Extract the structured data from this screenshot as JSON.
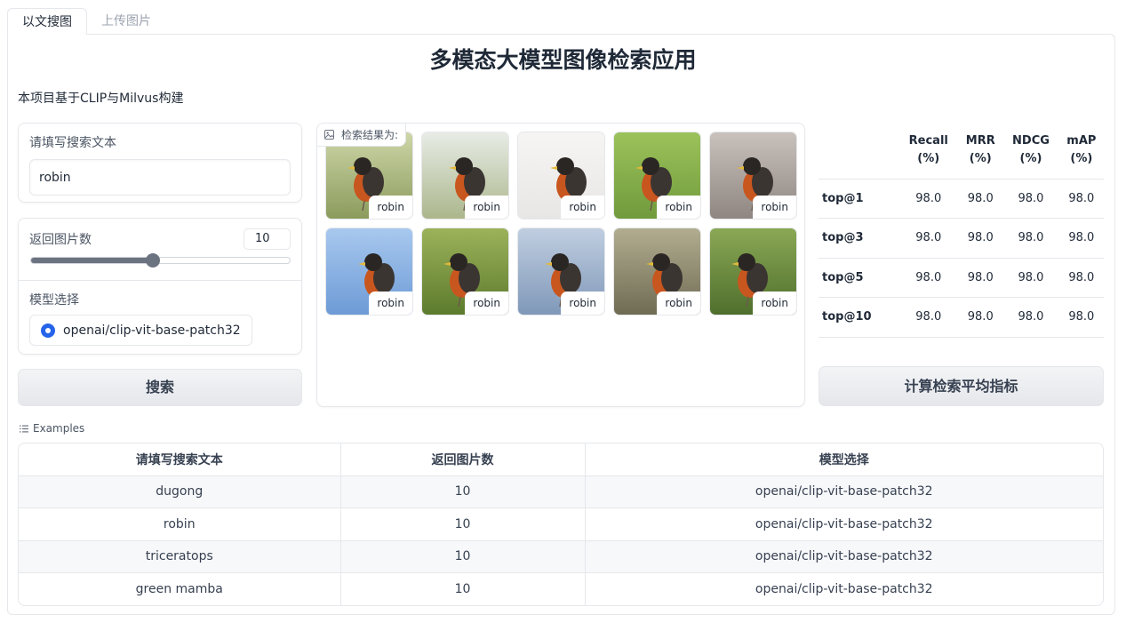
{
  "tabs": [
    {
      "label": "以文搜图",
      "active": true
    },
    {
      "label": "上传图片",
      "active": false
    }
  ],
  "title": "多模态大模型图像检索应用",
  "subtitle": "本项目基于CLIP与Milvus构建",
  "search": {
    "label": "请填写搜索文本",
    "value": "robin"
  },
  "count": {
    "label": "返回图片数",
    "value": "10",
    "fraction": 0.47
  },
  "model": {
    "label": "模型选择",
    "option": "openai/clip-vit-base-patch32"
  },
  "search_button": "搜索",
  "gallery": {
    "label": "检索结果为:",
    "captions": [
      "robin",
      "robin",
      "robin",
      "robin",
      "robin",
      "robin",
      "robin",
      "robin",
      "robin",
      "robin"
    ]
  },
  "metrics": {
    "headers": [
      [
        "Recall",
        "(%)"
      ],
      [
        "MRR",
        "(%)"
      ],
      [
        "NDCG",
        "(%)"
      ],
      [
        "mAP",
        "(%)"
      ]
    ],
    "rows": [
      {
        "label": "top@1",
        "values": [
          "98.0",
          "98.0",
          "98.0",
          "98.0"
        ]
      },
      {
        "label": "top@3",
        "values": [
          "98.0",
          "98.0",
          "98.0",
          "98.0"
        ]
      },
      {
        "label": "top@5",
        "values": [
          "98.0",
          "98.0",
          "98.0",
          "98.0"
        ]
      },
      {
        "label": "top@10",
        "values": [
          "98.0",
          "98.0",
          "98.0",
          "98.0"
        ]
      }
    ]
  },
  "calc_button": "计算检索平均指标",
  "examples": {
    "title": "Examples",
    "headers": [
      "请填写搜索文本",
      "返回图片数",
      "模型选择"
    ],
    "rows": [
      [
        "dugong",
        "10",
        "openai/clip-vit-base-patch32"
      ],
      [
        "robin",
        "10",
        "openai/clip-vit-base-patch32"
      ],
      [
        "triceratops",
        "10",
        "openai/clip-vit-base-patch32"
      ],
      [
        "green mamba",
        "10",
        "openai/clip-vit-base-patch32"
      ]
    ]
  },
  "colors": {
    "accent": "#2563eb",
    "slider": "#6b7280",
    "border": "#e5e7eb"
  }
}
